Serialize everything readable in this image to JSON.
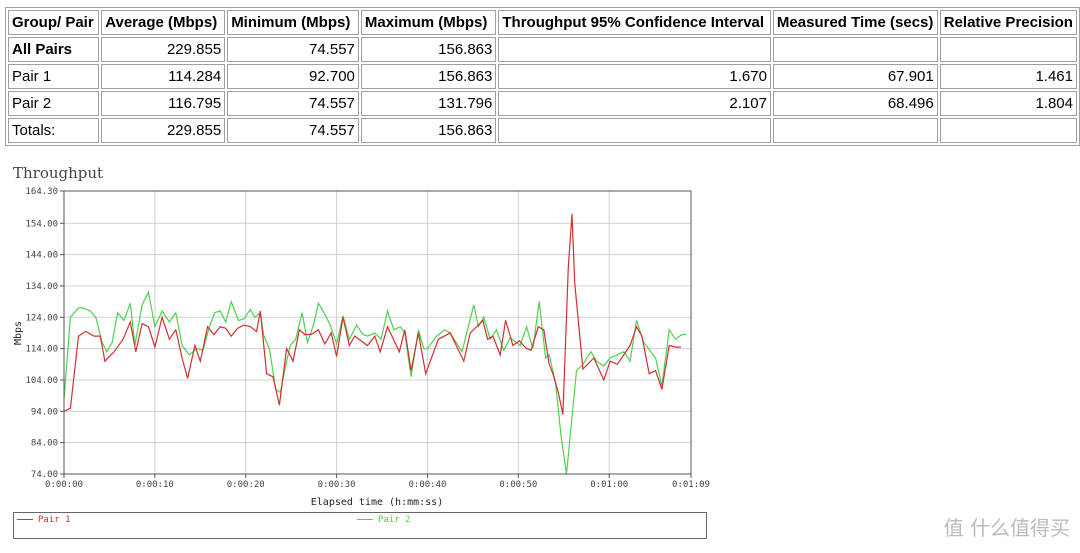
{
  "table": {
    "headers": [
      "Group/ Pair",
      "Average (Mbps)",
      "Minimum (Mbps)",
      "Maximum (Mbps)",
      "Throughput 95% Confidence Interval",
      "Measured Time (secs)",
      "Relative Precision"
    ],
    "rows": [
      [
        "All Pairs",
        "229.855",
        "74.557",
        "156.863",
        "",
        "",
        ""
      ],
      [
        "Pair 1",
        "114.284",
        "92.700",
        "156.863",
        "1.670",
        "67.901",
        "1.461"
      ],
      [
        "Pair 2",
        "116.795",
        "74.557",
        "131.796",
        "2.107",
        "68.496",
        "1.804"
      ],
      [
        "Totals:",
        "229.855",
        "74.557",
        "156.863",
        "",
        "",
        ""
      ]
    ]
  },
  "chart_data": {
    "type": "line",
    "title": "Throughput",
    "xlabel": "Elapsed time (h:mm:ss)",
    "ylabel": "Mbps",
    "xlim": [
      0,
      69
    ],
    "ylim": [
      74.0,
      164.3
    ],
    "yticks": [
      "74.00",
      "84.00",
      "94.00",
      "104.00",
      "114.00",
      "124.00",
      "134.00",
      "144.00",
      "154.00",
      "164.30"
    ],
    "xticks": [
      "0:00:00",
      "0:00:10",
      "0:00:20",
      "0:00:30",
      "0:00:40",
      "0:00:50",
      "0:01:00",
      "0:01:09"
    ],
    "grid": true,
    "legend": "bottom",
    "series": [
      {
        "name": "Pair 1",
        "color": "#d03030",
        "points": [
          [
            0,
            94
          ],
          [
            0.7,
            95
          ],
          [
            1.6,
            118
          ],
          [
            2.4,
            119.5
          ],
          [
            3.3,
            118
          ],
          [
            4,
            118
          ],
          [
            4.5,
            110
          ],
          [
            5.5,
            113
          ],
          [
            6.5,
            117
          ],
          [
            7.3,
            122.5
          ],
          [
            7.9,
            113
          ],
          [
            8.6,
            122
          ],
          [
            9.3,
            121
          ],
          [
            10,
            114.5
          ],
          [
            10.8,
            124
          ],
          [
            11.6,
            117
          ],
          [
            12.3,
            120
          ],
          [
            13,
            111
          ],
          [
            13.6,
            104.5
          ],
          [
            14.4,
            115
          ],
          [
            15,
            110
          ],
          [
            15.8,
            121
          ],
          [
            16.5,
            118.5
          ],
          [
            17.2,
            121
          ],
          [
            17.8,
            120.5
          ],
          [
            18.4,
            118
          ],
          [
            19.1,
            120.5
          ],
          [
            19.8,
            121.5
          ],
          [
            20.5,
            121
          ],
          [
            21.2,
            119.5
          ],
          [
            21.6,
            126
          ],
          [
            22.3,
            106
          ],
          [
            23,
            105
          ],
          [
            23.7,
            96
          ],
          [
            24.5,
            114
          ],
          [
            25.2,
            110
          ],
          [
            25.9,
            120
          ],
          [
            26.5,
            118.5
          ],
          [
            27.2,
            118.5
          ],
          [
            28,
            120
          ],
          [
            28.7,
            115.5
          ],
          [
            29.4,
            119
          ],
          [
            30,
            111.5
          ],
          [
            30.7,
            124
          ],
          [
            31.4,
            115
          ],
          [
            32,
            118
          ],
          [
            33.4,
            115
          ],
          [
            34.2,
            118
          ],
          [
            34.8,
            113
          ],
          [
            35.6,
            121
          ],
          [
            36.9,
            113
          ],
          [
            37.5,
            120
          ],
          [
            38.2,
            107
          ],
          [
            39,
            119
          ],
          [
            39.8,
            106
          ],
          [
            41.2,
            117
          ],
          [
            42.5,
            119
          ],
          [
            44,
            110
          ],
          [
            44.7,
            119
          ],
          [
            46.1,
            123
          ],
          [
            46.6,
            117
          ],
          [
            47.2,
            118
          ],
          [
            48,
            112
          ],
          [
            48.6,
            123
          ],
          [
            49.4,
            115
          ],
          [
            50.1,
            116.5
          ],
          [
            50.9,
            114
          ],
          [
            51.4,
            113.5
          ],
          [
            52.2,
            121
          ],
          [
            52.8,
            120
          ],
          [
            53.4,
            109
          ],
          [
            53.8,
            106
          ],
          [
            54.4,
            100
          ],
          [
            54.9,
            93
          ],
          [
            55.5,
            140
          ],
          [
            55.9,
            157
          ],
          [
            56.2,
            135
          ],
          [
            57.1,
            107.5
          ],
          [
            58.3,
            111
          ],
          [
            59.4,
            104
          ],
          [
            60.1,
            110
          ],
          [
            60.9,
            109
          ],
          [
            62.3,
            115
          ],
          [
            63,
            121
          ],
          [
            63.6,
            118
          ],
          [
            64.4,
            106
          ],
          [
            65.1,
            107
          ],
          [
            65.8,
            101
          ],
          [
            66.6,
            115
          ],
          [
            67.3,
            114.5
          ],
          [
            67.9,
            114.5
          ]
        ]
      },
      {
        "name": "Pair 2",
        "color": "#50d050",
        "points": [
          [
            0,
            98
          ],
          [
            0.7,
            124
          ],
          [
            1.6,
            127
          ],
          [
            2.1,
            127
          ],
          [
            2.9,
            126
          ],
          [
            3.5,
            124
          ],
          [
            4.2,
            116
          ],
          [
            4.7,
            113
          ],
          [
            5.3,
            116
          ],
          [
            5.9,
            125.5
          ],
          [
            6.6,
            123
          ],
          [
            7.3,
            128.5
          ],
          [
            7.8,
            115
          ],
          [
            8.6,
            128
          ],
          [
            9.3,
            132
          ],
          [
            10,
            121
          ],
          [
            10.8,
            126
          ],
          [
            11.6,
            122.5
          ],
          [
            12.3,
            125.5
          ],
          [
            13,
            115
          ],
          [
            13.8,
            112
          ],
          [
            14.6,
            114
          ],
          [
            15.3,
            113.5
          ],
          [
            16,
            121
          ],
          [
            16.6,
            125.5
          ],
          [
            17.2,
            126
          ],
          [
            17.8,
            122.5
          ],
          [
            18.4,
            129
          ],
          [
            19.2,
            123
          ],
          [
            19.8,
            123.5
          ],
          [
            20.5,
            126.5
          ],
          [
            21,
            124
          ],
          [
            21.6,
            125.5
          ],
          [
            22,
            118
          ],
          [
            22.6,
            114
          ],
          [
            23.3,
            101
          ],
          [
            23.8,
            100
          ],
          [
            24.5,
            110
          ],
          [
            24.9,
            115
          ],
          [
            25.5,
            117
          ],
          [
            26.2,
            125.5
          ],
          [
            26.8,
            116
          ],
          [
            27.5,
            122
          ],
          [
            28,
            128.5
          ],
          [
            28.7,
            125
          ],
          [
            29.3,
            121.5
          ],
          [
            30,
            115.5
          ],
          [
            30.7,
            124.5
          ],
          [
            31.4,
            117
          ],
          [
            32.2,
            121.5
          ],
          [
            32.9,
            118.5
          ],
          [
            33.4,
            118
          ],
          [
            34.2,
            119
          ],
          [
            34.9,
            117
          ],
          [
            35.6,
            126
          ],
          [
            36.3,
            120
          ],
          [
            37,
            121
          ],
          [
            37.5,
            119
          ],
          [
            38.2,
            105
          ],
          [
            39,
            120
          ],
          [
            39.6,
            114
          ],
          [
            40,
            114
          ],
          [
            41,
            118
          ],
          [
            41.9,
            120
          ],
          [
            42.5,
            119
          ],
          [
            43.8,
            113
          ],
          [
            45.1,
            128
          ],
          [
            45.6,
            121
          ],
          [
            46.2,
            124
          ],
          [
            46.9,
            117
          ],
          [
            47.6,
            120
          ],
          [
            48.4,
            113.5
          ],
          [
            49.1,
            117.5
          ],
          [
            50.2,
            115
          ],
          [
            50.9,
            121
          ],
          [
            51.6,
            114
          ],
          [
            52.3,
            129
          ],
          [
            53,
            111
          ],
          [
            53.4,
            112
          ],
          [
            54.1,
            103
          ],
          [
            54.7,
            86
          ],
          [
            55.3,
            74
          ],
          [
            56.4,
            107
          ],
          [
            57.1,
            109
          ],
          [
            58,
            113
          ],
          [
            58.6,
            110
          ],
          [
            59.4,
            108.5
          ],
          [
            60.1,
            111
          ],
          [
            61.6,
            113
          ],
          [
            62.3,
            110
          ],
          [
            63,
            123
          ],
          [
            63.8,
            116
          ],
          [
            65.1,
            111
          ],
          [
            65.8,
            102
          ],
          [
            66.6,
            120
          ],
          [
            67.3,
            117
          ],
          [
            68,
            118.5
          ],
          [
            68.5,
            118.5
          ]
        ]
      }
    ]
  },
  "watermark": "值 什么值得买"
}
